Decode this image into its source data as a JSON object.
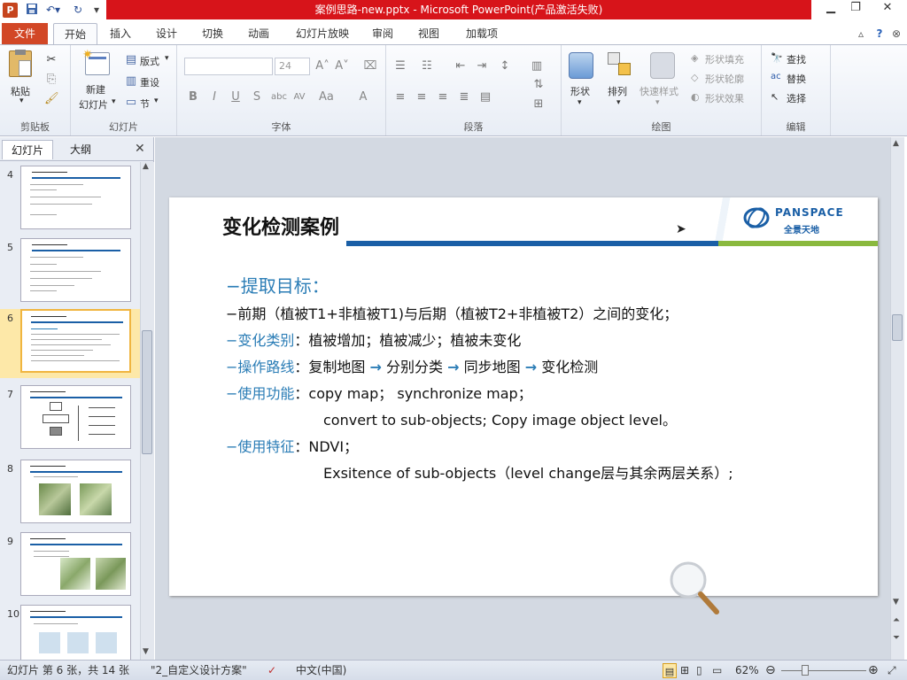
{
  "window": {
    "title": "案例思路-new.pptx  -  Microsoft PowerPoint(产品激活失败)"
  },
  "ribbon_tabs": {
    "file": "文件",
    "tabs": [
      "开始",
      "插入",
      "设计",
      "切换",
      "动画",
      "幻灯片放映",
      "审阅",
      "视图",
      "加载项"
    ],
    "active": "开始"
  },
  "ribbon": {
    "clipboard": {
      "label": "剪贴板",
      "paste": "粘贴"
    },
    "slides": {
      "label": "幻灯片",
      "new_slide": "新建\n幻灯片",
      "new_slide_1": "新建",
      "new_slide_2": "幻灯片",
      "layout": "版式",
      "reset": "重设",
      "section": "节"
    },
    "font": {
      "label": "字体",
      "size": "24"
    },
    "paragraph": {
      "label": "段落"
    },
    "drawing": {
      "label": "绘图",
      "shapes": "形状",
      "arrange": "排列",
      "quick_styles": "快速样式",
      "fill": "形状填充",
      "outline": "形状轮廓",
      "effects": "形状效果"
    },
    "editing": {
      "label": "编辑",
      "find": "查找",
      "replace": "替换",
      "select": "选择"
    }
  },
  "left_pane": {
    "tabs": [
      "幻灯片",
      "大纲"
    ],
    "active_tab": "幻灯片",
    "thumbnails": [
      {
        "num": "4"
      },
      {
        "num": "5"
      },
      {
        "num": "6",
        "selected": true
      },
      {
        "num": "7"
      },
      {
        "num": "8"
      },
      {
        "num": "9"
      },
      {
        "num": "10"
      }
    ]
  },
  "slide": {
    "title": "变化检测案例",
    "logo_text": "PANSPACE",
    "logo_sub": "全景天地",
    "heading": "−提取目标：",
    "lines": [
      {
        "text": "−前期（植被T1+非植被T1)与后期（植被T2+非植被T2）之间的变化；"
      },
      {
        "key": "−变化类别",
        "value": "：植被增加；植被减少；植被未变化"
      },
      {
        "key": "−操作路线",
        "value_parts": [
          "：复制地图",
          "分别分类",
          "同步地图",
          "变化检测"
        ]
      },
      {
        "key": "−使用功能",
        "value": "：copy map； synchronize map；"
      },
      {
        "indent": "convert to sub-objects;  Copy image object level。"
      },
      {
        "key": "−使用特征",
        "value": "：NDVI；"
      },
      {
        "indent": "Exsitence  of sub-objects（level  change层与其余两层关系）;"
      }
    ],
    "arrow_glyph": "→"
  },
  "statusbar": {
    "slide_info": "幻灯片 第 6 张，共 14 张",
    "theme": "\"2_自定义设计方案\"",
    "language": "中文(中国)",
    "zoom": "62%"
  },
  "colors": {
    "title_bar_red": "#d7141a",
    "file_tab": "#d24726",
    "slide_blue": "#2b7db6",
    "stripe_blue": "#1a5fa6",
    "stripe_green": "#8ab93e"
  }
}
